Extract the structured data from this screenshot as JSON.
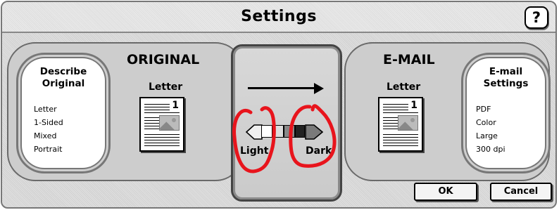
{
  "window": {
    "title": "Settings",
    "help_label": "?"
  },
  "original": {
    "section_title": "ORIGINAL",
    "describe_button": {
      "line1": "Describe",
      "line2": "Original"
    },
    "settings_list": [
      "Letter",
      "1-Sided",
      "Mixed",
      "Portrait"
    ],
    "doc_label": "Letter",
    "doc_page_number": "1"
  },
  "density": {
    "light_label": "Light",
    "dark_label": "Dark",
    "level_fraction": 0.5
  },
  "email": {
    "section_title": "E-MAIL",
    "settings_button": {
      "line1": "E-mail",
      "line2": "Settings"
    },
    "settings_list": [
      "PDF",
      "Color",
      "Large",
      "300 dpi"
    ],
    "doc_label": "Letter",
    "doc_page_number": "1"
  },
  "footer": {
    "ok_label": "OK",
    "cancel_label": "Cancel"
  },
  "colors": {
    "annotation": "#e8141c",
    "panel": "#cdcdcd",
    "border": "#6a6a6a"
  }
}
